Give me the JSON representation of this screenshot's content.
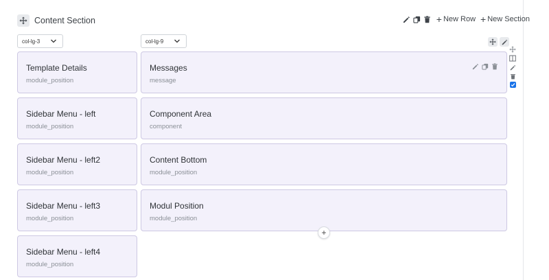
{
  "section": {
    "title": "Content Section",
    "actions": {
      "new_row": "New Row",
      "new_section": "New Section"
    }
  },
  "columns": [
    {
      "size": "col-lg-3",
      "modules": [
        {
          "title": "Template Details",
          "position": "module_position"
        },
        {
          "title": "Sidebar Menu - left",
          "position": "module_position"
        },
        {
          "title": "Sidebar Menu - left2",
          "position": "module_position"
        },
        {
          "title": "Sidebar Menu - left3",
          "position": "module_position"
        },
        {
          "title": "Sidebar Menu - left4",
          "position": "module_position"
        }
      ]
    },
    {
      "size": "col-lg-9",
      "modules": [
        {
          "title": "Messages",
          "position": "message"
        },
        {
          "title": "Component Area",
          "position": "component"
        },
        {
          "title": "Content Bottom",
          "position": "module_position"
        },
        {
          "title": "Modul Position",
          "position": "module_position"
        }
      ]
    }
  ],
  "add_symbol": "+",
  "colors": {
    "card_bg": "#f3f1fb",
    "card_border": "#cdc8e3",
    "checkbox": "#1a73e8"
  }
}
